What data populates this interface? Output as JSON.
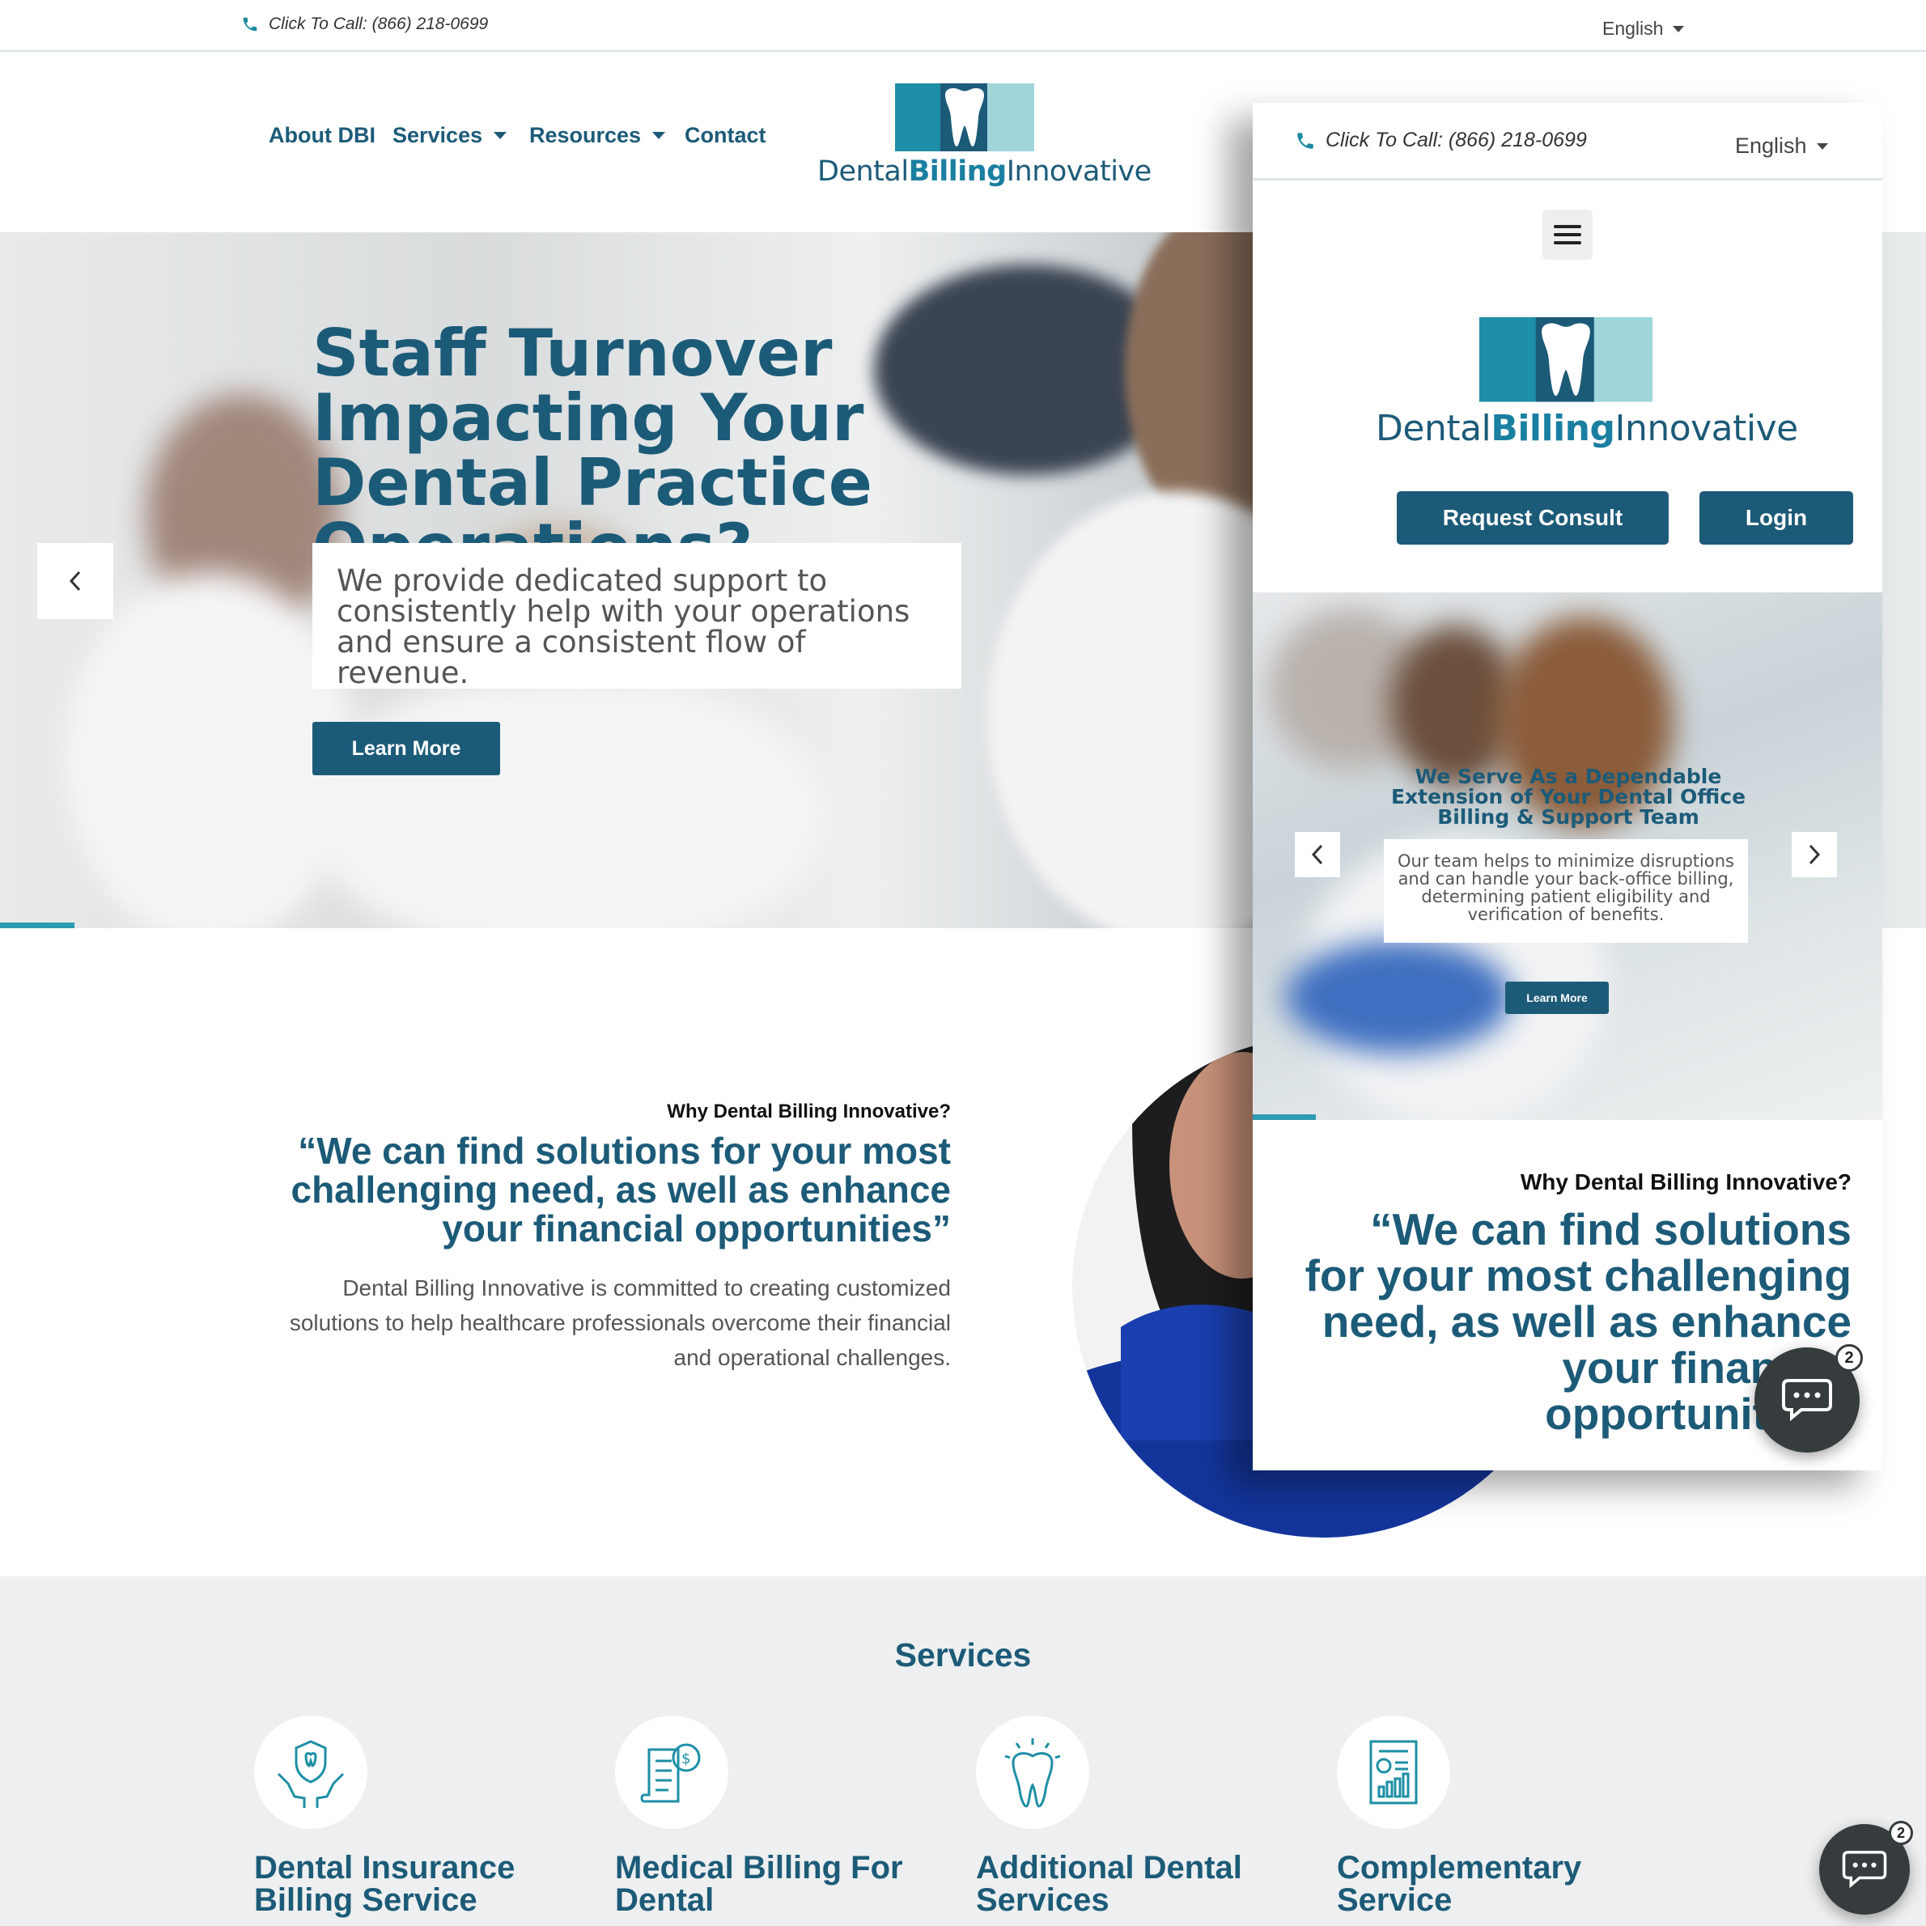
{
  "topbar": {
    "phone_text": "Click To Call: (866) 218-0699",
    "language": "English",
    "icon": "phone-icon"
  },
  "nav": {
    "items": [
      {
        "label": "About DBI",
        "has_dropdown": false
      },
      {
        "label": "Services",
        "has_dropdown": true
      },
      {
        "label": "Resources",
        "has_dropdown": true
      },
      {
        "label": "Contact",
        "has_dropdown": false
      }
    ]
  },
  "logo": {
    "part1": "Dental",
    "part2": "Billing",
    "part3": "Innovative"
  },
  "hero": {
    "title": "Staff Turnover Impacting Your Dental Practice Operations?",
    "subtitle": "We provide dedicated support to consistently help with your operations and ensure a consistent flow of revenue.",
    "cta": "Learn More"
  },
  "why": {
    "eyebrow": "Why Dental Billing Innovative?",
    "quote": "“We can find solutions for your most challenging need, as well as enhance your financial opportunities”",
    "body": "Dental Billing Innovative is committed to creating customized solutions to help healthcare professionals overcome their financial and operational challenges."
  },
  "services": {
    "title": "Services",
    "items": [
      {
        "title": "Dental Insurance Billing Service",
        "icon": "insurance-hands-icon"
      },
      {
        "title": "Medical Billing For Dental",
        "icon": "billing-receipt-icon"
      },
      {
        "title": "Additional Dental Services",
        "icon": "sparkling-tooth-icon"
      },
      {
        "title": "Complementary Service",
        "icon": "report-chart-icon"
      }
    ]
  },
  "mobile": {
    "phone_text": "Click To Call: (866) 218-0699",
    "language": "English",
    "request_consult": "Request Consult",
    "login": "Login",
    "hero_title": "We Serve As a Dependable Extension of Your Dental Office Billing & Support Team",
    "hero_body": "Our team helps to minimize disruptions and can handle your back-office billing, determining patient eligibility and verification of benefits.",
    "hero_cta": "Learn More",
    "why_eyebrow": "Why Dental Billing Innovative?",
    "why_quote": "“We can find solutions for your most challenging need, as well as enhance your financial opportunities”"
  },
  "chat": {
    "badge_count": "2"
  },
  "colors": {
    "brand": "#1c5b78",
    "accent": "#2d9bb1",
    "section_bg": "#eeeff0"
  }
}
